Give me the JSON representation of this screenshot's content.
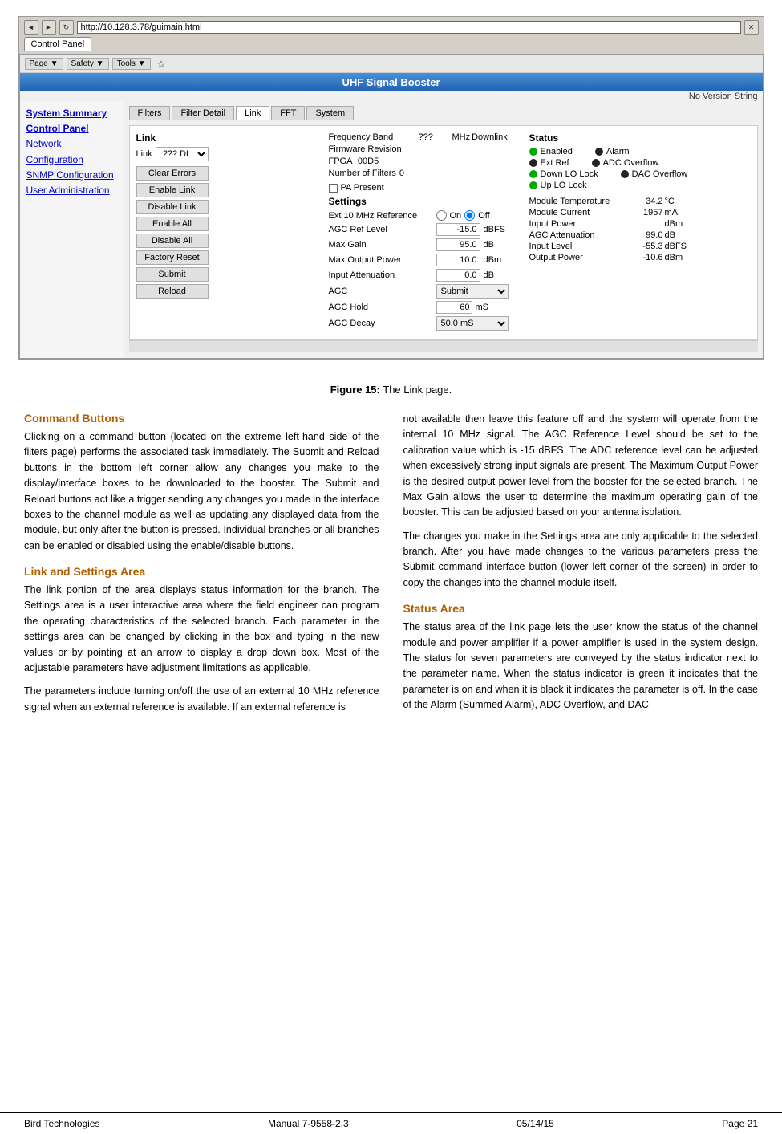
{
  "browser": {
    "address": "http://10.128.3.78/guimain.html",
    "tab_label": "Control Panel",
    "back_label": "◄",
    "forward_label": "►",
    "refresh_label": "↻",
    "close_label": "✕"
  },
  "app": {
    "title": "UHF Signal Booster",
    "no_version": "No Version String"
  },
  "toolbar": {
    "page_label": "Page ▼",
    "safety_label": "Safety ▼",
    "tools_label": "Tools ▼",
    "star_label": "☆"
  },
  "sidebar": {
    "items": [
      {
        "label": "System Summary"
      },
      {
        "label": "Control Panel"
      },
      {
        "label": "Network Configuration"
      },
      {
        "label": "SNMP Configuration"
      },
      {
        "label": "User Administration"
      }
    ]
  },
  "panel": {
    "tabs": [
      "Filters",
      "Filter Detail",
      "Link",
      "FFT",
      "System"
    ],
    "active_tab": "Link"
  },
  "link_section": {
    "title": "Link",
    "dropdown_label": "Link",
    "dropdown_value": "??? DL",
    "buttons": [
      "Clear Errors",
      "Enable Link",
      "Disable Link",
      "Enable All",
      "Disable All",
      "Factory Reset",
      "Submit",
      "Reload"
    ]
  },
  "link_info": {
    "frequency_band_label": "Frequency Band",
    "frequency_value": "???",
    "frequency_unit": "MHz",
    "downlink_label": "Downlink",
    "firmware_label": "Firmware Revision",
    "fpga_label": "FPGA",
    "fpga_value": "00D5",
    "num_filters_label": "Number of Filters",
    "num_filters_value": "0",
    "pa_present_label": "PA Present"
  },
  "settings": {
    "title": "Settings",
    "ext10_label": "Ext 10 MHz Reference",
    "ext10_on": "On",
    "ext10_off": "Off",
    "agc_ref_label": "AGC Ref Level",
    "agc_ref_value": "-15.0",
    "agc_ref_unit": "dBFS",
    "max_gain_label": "Max Gain",
    "max_gain_value": "95.0",
    "max_gain_unit": "dB",
    "max_output_label": "Max Output Power",
    "max_output_value": "10.0",
    "max_output_unit": "dBm",
    "input_atten_label": "Input Attenuation",
    "input_atten_value": "0.0",
    "input_atten_unit": "dB",
    "agc_label": "AGC",
    "agc_value": "Submit",
    "agc_hold_label": "AGC Hold",
    "agc_hold_value": "60",
    "agc_hold_unit": "mS",
    "agc_decay_label": "AGC Decay",
    "agc_decay_value": "50.0 mS"
  },
  "status": {
    "title": "Status",
    "indicators": [
      {
        "label": "Enabled",
        "color": "green"
      },
      {
        "label": "Alarm",
        "color": "black"
      },
      {
        "label": "Ext Ref",
        "color": "black"
      },
      {
        "label": "ADC Overflow",
        "color": "black"
      },
      {
        "label": "Down LO Lock",
        "color": "green"
      },
      {
        "label": "DAC Overflow",
        "color": "black"
      },
      {
        "label": "Up LO Lock",
        "color": "green"
      }
    ],
    "data": [
      {
        "label": "Module Temperature",
        "value": "34.2",
        "unit": "°C"
      },
      {
        "label": "Module Current",
        "value": "1957",
        "unit": "mA"
      },
      {
        "label": "Input Power",
        "value": "",
        "unit": "dBm"
      },
      {
        "label": "AGC Attenuation",
        "value": "99.0",
        "unit": "dB"
      },
      {
        "label": "Input Level",
        "value": "-55.3",
        "unit": "dBFS"
      },
      {
        "label": "Output Power",
        "value": "-10.6",
        "unit": "dBm"
      }
    ]
  },
  "figure": {
    "number": "Figure 15:",
    "caption": "The Link page."
  },
  "content": {
    "col1": {
      "sections": [
        {
          "heading": "Command Buttons",
          "paragraphs": [
            "Clicking on a command button (located on the extreme left-hand side of the filters page) performs the associated task immediately. The Submit and Reload buttons in the bottom left corner allow any changes you make to the display/interface boxes to be downloaded to the booster. The Submit and Reload buttons act like a trigger sending any changes you made in the interface boxes to the channel module as well as updating any displayed data from the module, but only after the button is pressed. Individual branches or all branches can be enabled or disabled using the enable/disable buttons."
          ]
        },
        {
          "heading": "Link and Settings Area",
          "paragraphs": [
            "The link portion of the area displays status information for the branch. The Settings area is a user interactive area where the field engineer can program the operating characteristics of the selected branch. Each parameter in the settings area can be changed by clicking in the box and typing in the new values or by pointing at an arrow to display a drop down box. Most of the adjustable parameters have adjustment limitations as applicable.",
            "The parameters include turning on/off the use of an external 10 MHz reference signal when an external reference is available. If an external reference is"
          ]
        }
      ]
    },
    "col2": {
      "paragraphs": [
        "not available then leave this feature off and the system will operate from the internal 10 MHz signal. The AGC Reference Level should be set to the calibration value which is -15 dBFS. The ADC reference level can be adjusted when excessively strong input signals are present. The Maximum Output Power is the desired output power level from the booster for the selected branch. The Max Gain allows the user to determine the maximum operating gain of the booster. This can be adjusted based on your antenna isolation.",
        "The changes you make in the Settings area are only applicable to the selected branch. After you have made changes to the various parameters press the Submit command interface button (lower left corner of the screen) in order to copy the changes into the channel module itself."
      ],
      "sections": [
        {
          "heading": "Status Area",
          "paragraphs": [
            "The status area of the link page lets the user know the status of the channel module and power amplifier if a power amplifier is used in the system design. The status for seven parameters are conveyed by the status indicator next to the parameter name. When the status indicator is green it indicates that the parameter is on and when it is black it indicates the parameter is off. In the case of the Alarm (Summed Alarm), ADC Overflow, and DAC"
          ]
        }
      ]
    }
  },
  "footer": {
    "left": "Bird Technologies",
    "center": "Manual 7-9558-2.3",
    "center_label": "05/14/15",
    "right": "Page 21"
  }
}
